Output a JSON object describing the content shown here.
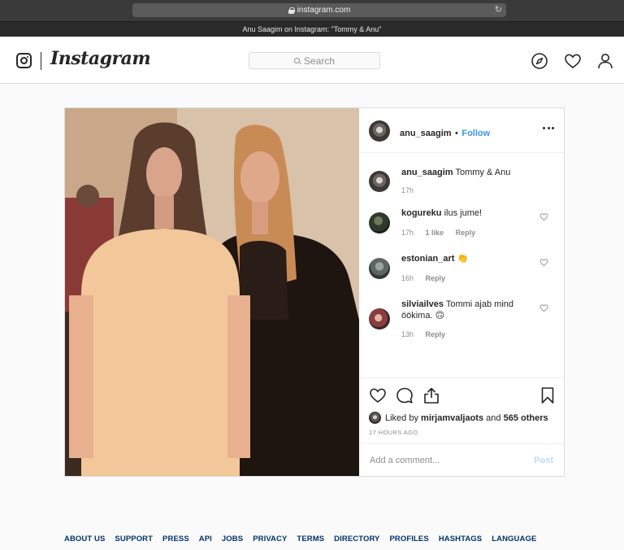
{
  "browser": {
    "url": "instagram.com",
    "window_title": "Anu Saagim on Instagram: \"Tommy & Anu\""
  },
  "header": {
    "wordmark": "Instagram",
    "search_placeholder": "Search",
    "icons": [
      "instagram-glyph-icon",
      "compass-icon",
      "heart-icon",
      "profile-icon"
    ]
  },
  "post": {
    "username": "anu_saagim",
    "dot": "•",
    "follow_label": "Follow",
    "caption": {
      "username": "anu_saagim",
      "text": "Tommy & Anu",
      "time": "17h"
    },
    "comments": [
      {
        "username": "kogureku",
        "text": "ilus jume!",
        "time": "17h",
        "likes": "1 like",
        "reply": "Reply"
      },
      {
        "username": "estonian_art",
        "text": "👏",
        "time": "16h",
        "likes": "",
        "reply": "Reply"
      },
      {
        "username": "silviailves",
        "text": "Tommi ajab mind öökima. 🙃",
        "time": "13h",
        "likes": "",
        "reply": "Reply"
      }
    ],
    "liked_by_prefix": "Liked by",
    "liked_by_user": "mirjamvaljaots",
    "liked_by_and": "and",
    "liked_by_others": "565 others",
    "time_ago": "17 HOURS AGO",
    "comment_placeholder": "Add a comment...",
    "post_button": "Post"
  },
  "footer": {
    "links": [
      "ABOUT US",
      "SUPPORT",
      "PRESS",
      "API",
      "JOBS",
      "PRIVACY",
      "TERMS",
      "DIRECTORY",
      "PROFILES",
      "HASHTAGS",
      "LANGUAGE"
    ]
  },
  "colors": {
    "link_blue": "#3897f0",
    "footer_link": "#003569",
    "border": "#dbdbdb",
    "muted": "#8e8e8e"
  }
}
